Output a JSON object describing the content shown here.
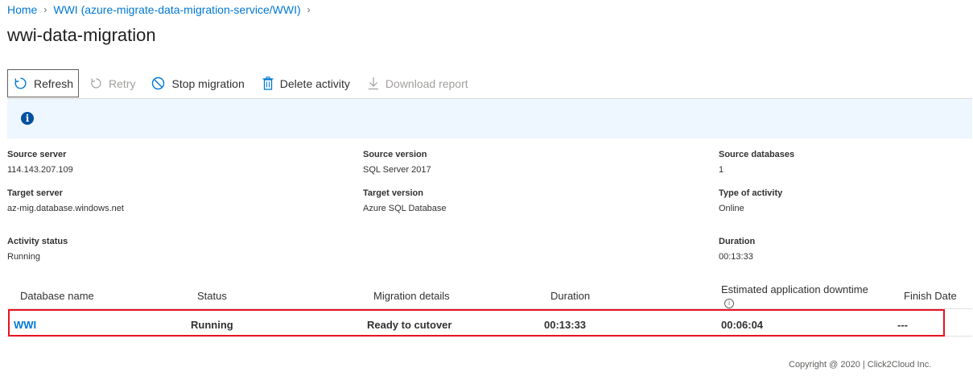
{
  "breadcrumb": {
    "home": "Home",
    "service": "WWI (azure-migrate-data-migration-service/WWI)"
  },
  "page_title": "wwi-data-migration",
  "toolbar": {
    "refresh": "Refresh",
    "retry": "Retry",
    "stop": "Stop migration",
    "delete": "Delete activity",
    "download": "Download report"
  },
  "details": {
    "source_server": {
      "label": "Source server",
      "value": "114.143.207.109"
    },
    "source_version": {
      "label": "Source version",
      "value": "SQL Server 2017"
    },
    "source_databases": {
      "label": "Source databases",
      "value": "1"
    },
    "target_server": {
      "label": "Target server",
      "value": "az-mig.database.windows.net"
    },
    "target_version": {
      "label": "Target version",
      "value": "Azure SQL Database"
    },
    "type_of_activity": {
      "label": "Type of activity",
      "value": "Online"
    },
    "activity_status": {
      "label": "Activity status",
      "value": "Running"
    },
    "duration": {
      "label": "Duration",
      "value": "00:13:33"
    }
  },
  "table": {
    "columns": [
      "Database name",
      "Status",
      "Migration details",
      "Duration",
      "Estimated application downtime",
      "Finish Date"
    ],
    "rows": [
      {
        "database": "WWI",
        "status": "Running",
        "details": "Ready to cutover",
        "duration": "00:13:33",
        "downtime": "00:06:04",
        "finish": "---"
      }
    ]
  },
  "footer": "Copyright @ 2020  |   Click2Cloud Inc.",
  "colors": {
    "accent": "#0078d4",
    "highlight": "#e81123",
    "infobar": "#eef6ff"
  }
}
